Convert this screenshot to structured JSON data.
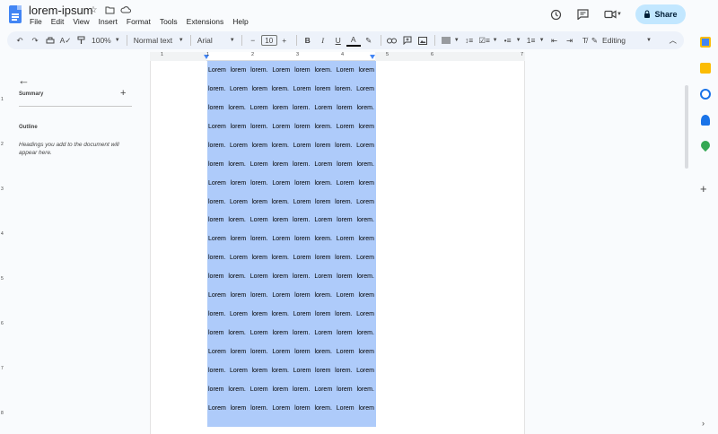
{
  "doc": {
    "title": "lorem-ipsum"
  },
  "menu": [
    "File",
    "Edit",
    "View",
    "Insert",
    "Format",
    "Tools",
    "Extensions",
    "Help"
  ],
  "header": {
    "share_label": "Share"
  },
  "toolbar": {
    "zoom": "100%",
    "style": "Normal text",
    "font": "Arial",
    "font_size": "10",
    "mode": "Editing"
  },
  "side": {
    "summary_label": "Summary",
    "outline_label": "Outline",
    "outline_hint": "Headings you add to the document will appear here."
  },
  "ruler": {
    "h_numbers": [
      "1",
      "1",
      "2",
      "3",
      "4",
      "5",
      "6",
      "7"
    ],
    "v_numbers": [
      "1",
      "2",
      "3",
      "4",
      "5",
      "6",
      "7",
      "8"
    ]
  },
  "content": {
    "lines": [
      "Lorem lorem lorem. Lorem lorem lorem. Lorem lorem",
      "lorem. Lorem lorem lorem. Lorem lorem lorem. Lorem",
      "lorem lorem. Lorem lorem lorem. Lorem lorem lorem.",
      "Lorem lorem lorem. Lorem lorem lorem. Lorem lorem",
      "lorem. Lorem lorem lorem. Lorem lorem lorem. Lorem",
      "lorem lorem. Lorem lorem lorem. Lorem lorem lorem.",
      "Lorem lorem lorem. Lorem lorem lorem. Lorem lorem",
      "lorem. Lorem lorem lorem. Lorem lorem lorem. Lorem",
      "lorem lorem. Lorem lorem lorem. Lorem lorem lorem.",
      "Lorem lorem lorem. Lorem lorem lorem. Lorem lorem",
      "lorem. Lorem lorem lorem. Lorem lorem lorem. Lorem",
      "lorem lorem. Lorem lorem lorem. Lorem lorem lorem.",
      "Lorem lorem lorem. Lorem lorem lorem. Lorem lorem",
      "lorem. Lorem lorem lorem. Lorem lorem lorem. Lorem",
      "lorem lorem. Lorem lorem lorem. Lorem lorem lorem.",
      "Lorem lorem lorem. Lorem lorem lorem. Lorem lorem",
      "lorem. Lorem lorem lorem. Lorem lorem lorem. Lorem",
      "lorem lorem. Lorem lorem lorem. Lorem lorem lorem.",
      "Lorem lorem lorem. Lorem lorem lorem. Lorem lorem"
    ]
  },
  "colors": {
    "accent": "#4285f4",
    "selection": "#aecbfa",
    "share_bg": "#c2e7ff",
    "toolbar_bg": "#edf2fa"
  },
  "icons": {
    "title": [
      "star-icon",
      "folder-icon",
      "cloud-icon"
    ],
    "header_right": [
      "history-icon",
      "comment-icon",
      "video-call-icon",
      "lock-icon"
    ],
    "right_rail": [
      "calendar-icon",
      "keep-icon",
      "tasks-icon",
      "contacts-icon",
      "maps-icon",
      "add-icon"
    ]
  }
}
